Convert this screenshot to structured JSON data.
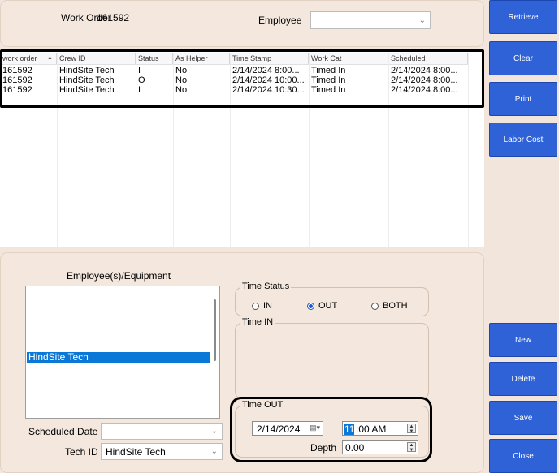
{
  "header": {
    "work_order_label": "Work Order",
    "work_order_value": "161592",
    "employee_label": "Employee",
    "employee_value": ""
  },
  "grid": {
    "columns": [
      "work order",
      "Crew ID",
      "Status",
      "As Helper",
      "Time Stamp",
      "Work Cat",
      "Scheduled"
    ],
    "sort_indicator": "▲",
    "rows": [
      [
        "161592",
        "HindSite Tech",
        "I",
        "No",
        "2/14/2024  8:00...",
        "Timed In",
        "2/14/2024  8:00..."
      ],
      [
        "161592",
        "HindSite Tech",
        "O",
        "No",
        "2/14/2024  10:00...",
        "Timed In",
        "2/14/2024  8:00..."
      ],
      [
        "161592",
        "HindSite Tech",
        "I",
        "No",
        "2/14/2024  10:30...",
        "Timed In",
        "2/14/2024  8:00..."
      ]
    ]
  },
  "side_buttons": {
    "retrieve": "Retrieve",
    "clear": "Clear",
    "print": "Print",
    "labor_cost": "Labor Cost",
    "new": "New",
    "delete": "Delete",
    "save": "Save",
    "close": "Close"
  },
  "employees": {
    "title": "Employee(s)/Equipment",
    "items": [
      "HindSite Tech"
    ],
    "selected_index": 0
  },
  "form": {
    "scheduled_date_label": "Scheduled Date",
    "scheduled_date_value": "",
    "tech_id_label": "Tech ID",
    "tech_id_value": "HindSite Tech"
  },
  "time_status": {
    "legend": "Time Status",
    "options": [
      "IN",
      "OUT",
      "BOTH"
    ],
    "selected": "OUT"
  },
  "time_in": {
    "legend": "Time IN"
  },
  "time_out": {
    "legend": "Time OUT",
    "date": "2/14/2024",
    "time_hour": "11",
    "time_rest": ":00 AM",
    "depth_label": "Depth",
    "depth_value": "0.00"
  },
  "colors": {
    "button_blue": "#2f62d6",
    "selection_blue": "#0a78d7",
    "panel_bg": "#f3e7de",
    "callout_border": "#000000"
  }
}
